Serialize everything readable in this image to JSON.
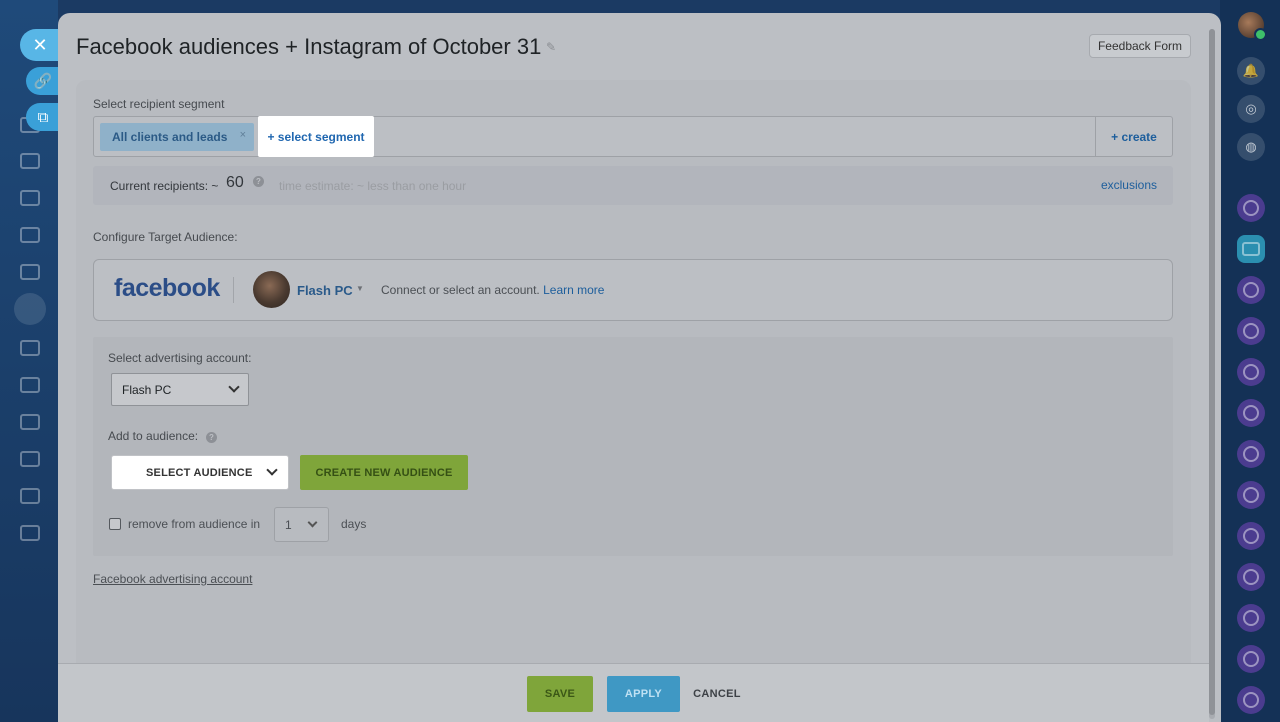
{
  "slider": {
    "title": "Facebook audiences + Instagram of October 31",
    "feedback_label": "Feedback Form"
  },
  "segments": {
    "label": "Select recipient segment",
    "chip_label": "All clients and leads",
    "chip_remove": "×",
    "select_label": "+ select segment",
    "create_label": "+ create"
  },
  "recipients": {
    "label": "Current recipients: ~",
    "count": "60",
    "help": "?",
    "estimate": "time estimate: ~ less than one hour",
    "exclusions": "exclusions"
  },
  "target": {
    "label": "Configure Target Audience:",
    "network_logo": "facebook",
    "account_name": "Flash PC",
    "connect_text": "Connect or select an account.",
    "learn_more": "Learn more"
  },
  "advertising": {
    "account_label": "Select advertising account:",
    "account_value": "Flash PC",
    "audience_label": "Add to audience:",
    "audience_help": "?",
    "select_audience": "SELECT AUDIENCE",
    "create_audience": "CREATE NEW AUDIENCE",
    "remove_label": "remove from audience in",
    "days_value": "1",
    "days_label": "days"
  },
  "fb_account_link": "Facebook advertising account",
  "footer": {
    "save": "SAVE",
    "apply": "APPLY",
    "cancel": "CANCEL"
  },
  "colors": {
    "accent_green": "#7fa53a",
    "accent_blue": "#3f98c4",
    "link_blue": "#1d5e9c"
  },
  "icons": [
    "close-icon",
    "link-icon",
    "external-link-icon",
    "pencil-icon",
    "bell-icon",
    "chevron-down-icon",
    "help-icon"
  ]
}
